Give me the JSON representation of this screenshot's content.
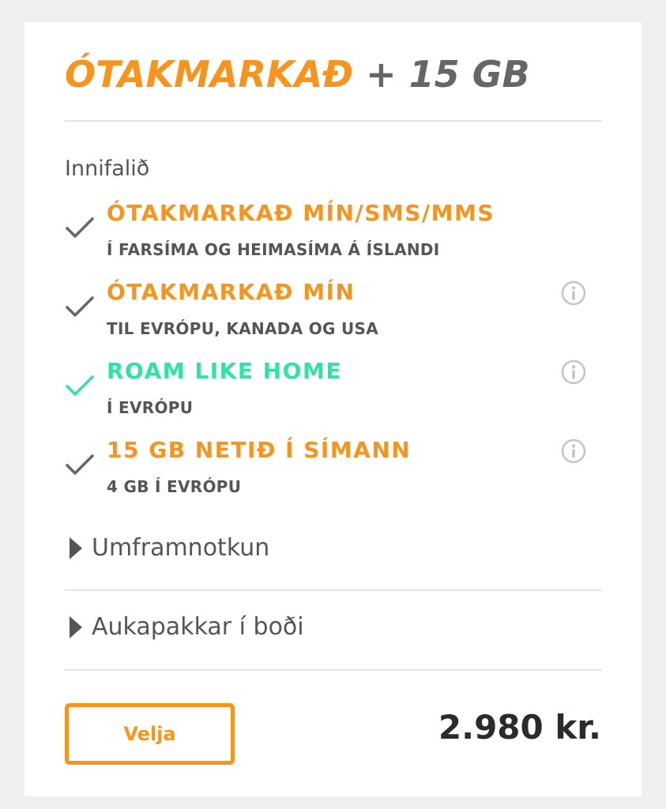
{
  "plan": {
    "title_highlight": "ÓTAKMARKAÐ",
    "title_rest": "+ 15 GB"
  },
  "included": {
    "label": "Innifalið",
    "features": [
      {
        "title": "ÓTAKMARKAÐ MÍN/SMS/MMS",
        "subtitle": "Í FARSÍMA OG HEIMASÍMA Á ÍSLANDI",
        "color": "#f7941d",
        "check_color": "#666666",
        "has_info": false
      },
      {
        "title": "ÓTAKMARKAÐ MÍN",
        "subtitle": "TIL EVRÓPU, KANADA OG USA",
        "color": "#f7941d",
        "check_color": "#666666",
        "has_info": true
      },
      {
        "title": "ROAM LIKE HOME",
        "subtitle": "Í EVRÓPU",
        "color": "#2fe3a4",
        "check_color": "#2fe3a4",
        "has_info": true
      },
      {
        "title": "15 GB NETIÐ Í SÍMANN",
        "subtitle": "4 GB Í EVRÓPU",
        "color": "#f7941d",
        "check_color": "#666666",
        "has_info": true
      }
    ]
  },
  "sections": {
    "overuse": "Umframnotkun",
    "addons": "Aukapakkar í boði"
  },
  "footer": {
    "select_label": "Velja",
    "price": "2.980 kr."
  },
  "colors": {
    "accent": "#f7941d",
    "teal": "#2fe3a4",
    "text": "#555555"
  }
}
